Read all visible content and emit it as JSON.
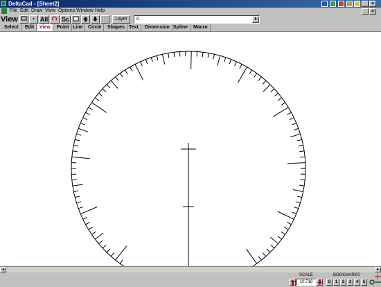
{
  "window": {
    "title": "DeltaCad - [Sheet2]"
  },
  "title_buttons": {
    "minimize": "_",
    "restore": "❐",
    "close": "×"
  },
  "menu": {
    "items": [
      "File",
      "Edit",
      "Draw",
      "View",
      "Options",
      "Window",
      "Help"
    ]
  },
  "toolbar": {
    "title": "View",
    "buttons": [
      "All",
      "Sc"
    ],
    "layer_label": "Layer",
    "layer_value": "0",
    "layer_drop": "⬇"
  },
  "tabs": {
    "items": [
      "Select",
      "Edit",
      "View",
      "Point",
      "Line",
      "Circle",
      "Shapes",
      "Text",
      "Dimension",
      "Spline",
      "Macro"
    ],
    "active": "View"
  },
  "status": {
    "scale_label": "SCALE",
    "scale_value": "10.718",
    "bookmarks_label": "BOOKMARKS",
    "bookmarks": [
      "S",
      "1",
      "2",
      "3",
      "4",
      "5"
    ]
  },
  "colors": {
    "accent_tab": "#c00000",
    "title_bar": "#08246b"
  }
}
